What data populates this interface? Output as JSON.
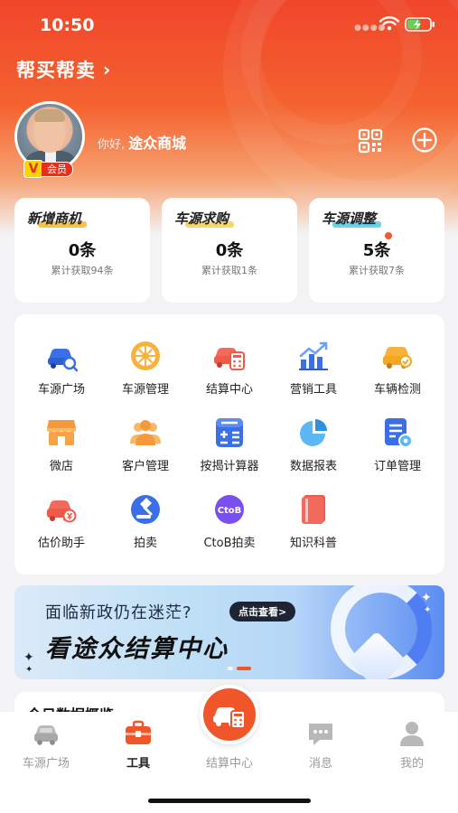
{
  "status": {
    "time": "10:50"
  },
  "header": {
    "title": "帮买帮卖",
    "greeting": "你好,",
    "store_name": "途众商城",
    "vip_badge": "V",
    "vip_label": "会员"
  },
  "stats": [
    {
      "label": "新增商机",
      "value": "0条",
      "sub": "累计获取94条",
      "color": "#f6c24a"
    },
    {
      "label": "车源求购",
      "value": "0条",
      "sub": "累计获取1条",
      "color": "#f8d76a"
    },
    {
      "label": "车源调整",
      "value": "5条",
      "sub": "累计获取7条",
      "color": "#6fd0ea"
    }
  ],
  "tools": [
    {
      "label": "车源广场",
      "icon": "car-search-icon"
    },
    {
      "label": "车源管理",
      "icon": "wheel-icon"
    },
    {
      "label": "结算中心",
      "icon": "car-calculator-icon"
    },
    {
      "label": "营销工具",
      "icon": "bar-chart-icon"
    },
    {
      "label": "车辆检测",
      "icon": "car-inspect-icon"
    },
    {
      "label": "微店",
      "icon": "shop-icon"
    },
    {
      "label": "客户管理",
      "icon": "customers-icon"
    },
    {
      "label": "按揭计算器",
      "icon": "calculator-icon"
    },
    {
      "label": "数据报表",
      "icon": "pie-chart-icon"
    },
    {
      "label": "订单管理",
      "icon": "order-settings-icon"
    },
    {
      "label": "估价助手",
      "icon": "car-price-icon"
    },
    {
      "label": "拍卖",
      "icon": "gavel-icon"
    },
    {
      "label": "CtoB拍卖",
      "icon": "ctob-icon"
    },
    {
      "label": "知识科普",
      "icon": "book-icon"
    }
  ],
  "banner": {
    "line1": "面临新政仍在迷茫?",
    "cta": "点击查看>",
    "line2": "看途众结算中心"
  },
  "overview_title": "今日数据概览",
  "tabbar": [
    {
      "label": "车源广场",
      "icon": "car-icon",
      "active": false
    },
    {
      "label": "工具",
      "icon": "toolbox-icon",
      "active": true
    },
    {
      "label": "结算中心",
      "icon": "car-calculator-icon",
      "active": false
    },
    {
      "label": "消息",
      "icon": "message-icon",
      "active": false
    },
    {
      "label": "我的",
      "icon": "person-icon",
      "active": false
    }
  ],
  "colors": {
    "accent": "#f0562a",
    "hero_top": "#f0462a"
  }
}
